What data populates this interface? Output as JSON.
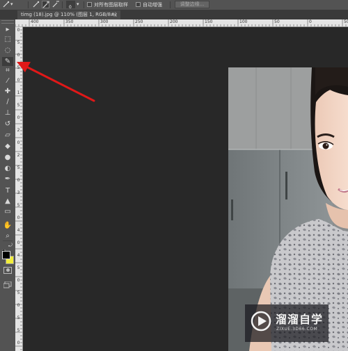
{
  "options_bar": {
    "tool_preset_icon": "quick-selection-icon",
    "brush_size": "0",
    "sample_all_layers_label": "对所有图层取样",
    "auto_enhance_label": "自动增强",
    "refine_edge_label": "调整边缘..."
  },
  "document": {
    "tab_title": "timg (18).jpg @ 110% (图层 1, RGB/8#) *",
    "close_glyph": "×"
  },
  "toolbox": {
    "tools": [
      {
        "name": "move-tool",
        "icon": "▸"
      },
      {
        "name": "marquee-tool",
        "icon": "⬚"
      },
      {
        "name": "lasso-tool",
        "icon": "◌"
      },
      {
        "name": "quick-selection-tool",
        "icon": "✎",
        "active": true
      },
      {
        "name": "crop-tool",
        "icon": "⌗"
      },
      {
        "name": "eyedropper-tool",
        "icon": "⁄"
      },
      {
        "name": "healing-brush-tool",
        "icon": "✚"
      },
      {
        "name": "brush-tool",
        "icon": "∕"
      },
      {
        "name": "clone-stamp-tool",
        "icon": "⊥"
      },
      {
        "name": "history-brush-tool",
        "icon": "↺"
      },
      {
        "name": "eraser-tool",
        "icon": "▱"
      },
      {
        "name": "paint-bucket-tool",
        "icon": "◆"
      },
      {
        "name": "blur-tool",
        "icon": "●"
      },
      {
        "name": "dodge-tool",
        "icon": "◐"
      },
      {
        "name": "pen-tool",
        "icon": "✒"
      },
      {
        "name": "type-tool",
        "icon": "T"
      },
      {
        "name": "path-selection-tool",
        "icon": "▲"
      },
      {
        "name": "rectangle-tool",
        "icon": "▭"
      },
      {
        "name": "hand-tool",
        "icon": "✋"
      },
      {
        "name": "zoom-tool",
        "icon": "⌕"
      }
    ],
    "foreground_color": "#000000",
    "background_color": "#f2ee3a"
  },
  "rulers": {
    "top_labels": [
      "400",
      "350",
      "300",
      "250",
      "200",
      "150",
      "100",
      "50",
      "0",
      "50"
    ],
    "left_labels": [
      "0",
      "5",
      "0",
      "5",
      "0",
      "1",
      "5",
      "0",
      "2",
      "0",
      "2",
      "5",
      "0",
      "3",
      "5",
      "0",
      "4",
      "0",
      "4",
      "5",
      "0",
      "5",
      "0",
      "5",
      "5",
      "0"
    ]
  },
  "watermark": {
    "title": "溜溜自学",
    "subtitle": "ZIXUE.3D66.COM"
  },
  "colors": {
    "arrow": "#e01818",
    "canvas_bg": "#282828",
    "panel_bg": "#535353"
  }
}
